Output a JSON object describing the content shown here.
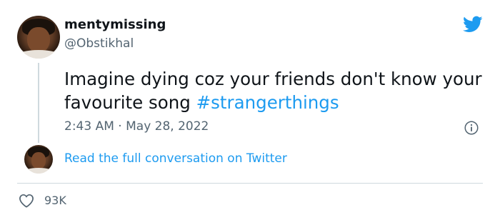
{
  "tweet": {
    "display_name": "mentymissing",
    "handle": "@Obstikhal",
    "text": "Imagine dying coz your friends don't know your favourite song ",
    "hashtag": "#strangerthings",
    "time": "2:43 AM",
    "separator": "·",
    "date": "May 28, 2022",
    "read_more": "Read the full conversation on Twitter",
    "likes": "93K"
  },
  "icons": {
    "logo": "twitter-bird-icon",
    "info": "info-icon",
    "like": "heart-icon"
  },
  "colors": {
    "accent": "#1d9bf0",
    "text": "#0f1419",
    "muted": "#536471",
    "divider": "#cfd9de"
  }
}
